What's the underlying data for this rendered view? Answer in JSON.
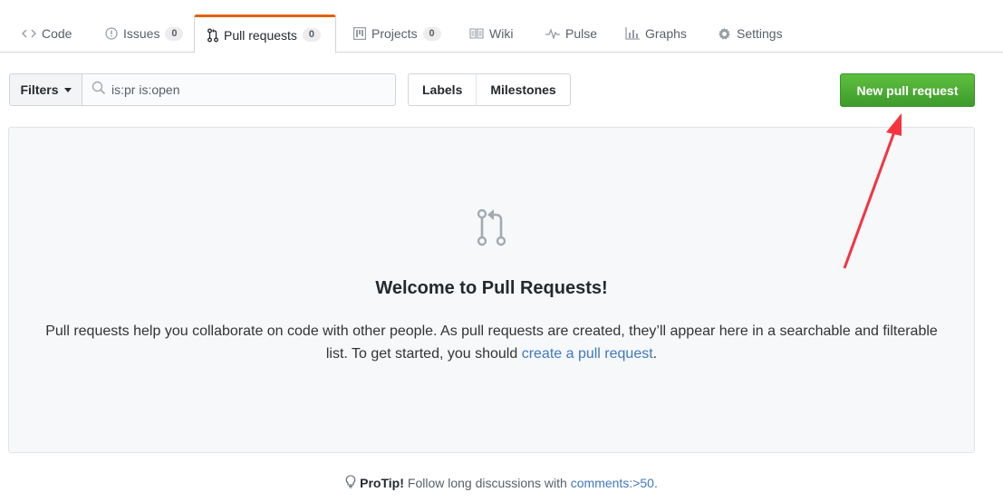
{
  "tabs": [
    {
      "label": "Code",
      "icon": "code-icon"
    },
    {
      "label": "Issues",
      "count": "0",
      "icon": "issue-icon"
    },
    {
      "label": "Pull requests",
      "count": "0",
      "icon": "git-pull-request-icon",
      "selected": true
    },
    {
      "label": "Projects",
      "count": "0",
      "icon": "project-icon"
    },
    {
      "label": "Wiki",
      "icon": "book-icon"
    },
    {
      "label": "Pulse",
      "icon": "pulse-icon"
    },
    {
      "label": "Graphs",
      "icon": "graph-icon"
    },
    {
      "label": "Settings",
      "icon": "gear-icon"
    }
  ],
  "subnav": {
    "filters_label": "Filters",
    "search_value": "is:pr is:open",
    "labels_label": "Labels",
    "milestones_label": "Milestones",
    "new_pr_label": "New pull request"
  },
  "blankslate": {
    "title": "Welcome to Pull Requests!",
    "text_before": "Pull requests help you collaborate on code with other people. As pull requests are created, they’ll appear here in a searchable and filterable list. To get started, you should ",
    "link_text": "create a pull request",
    "text_after": "."
  },
  "protip": {
    "bold": "ProTip!",
    "text": "Follow long discussions with",
    "link": "comments:>50",
    "suffix": "."
  },
  "colors": {
    "accent_tab": "#e36209",
    "primary_button": "#4cae33",
    "link": "#4078c0",
    "annotation_arrow": "#f5333f"
  }
}
